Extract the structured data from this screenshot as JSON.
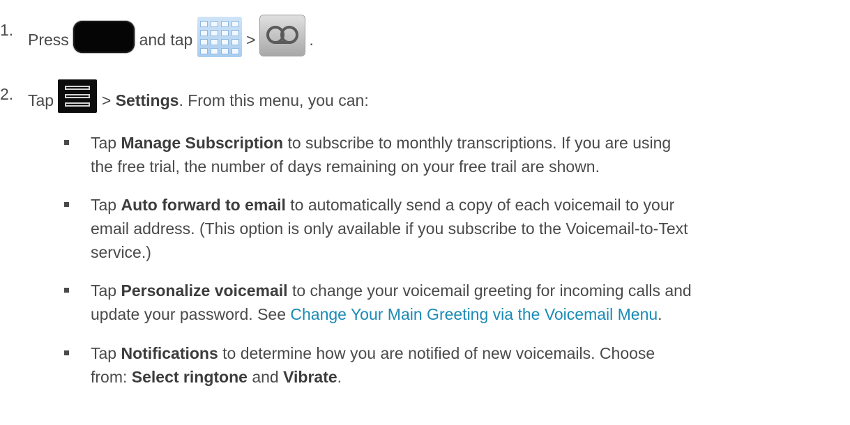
{
  "step1": {
    "number": "1.",
    "press": "Press",
    "and_tap": "and tap",
    "gt": ">",
    "period": ".",
    "home_key_icon": "home-key-icon",
    "apps_icon": "apps-grid-icon",
    "voicemail_icon": "voicemail-icon"
  },
  "step2": {
    "number": "2.",
    "tap": "Tap",
    "gt": ">",
    "settings": "Settings",
    "rest": ". From this menu, you can:",
    "menu_icon": "menu-key-icon"
  },
  "bullets": [
    {
      "lines": [
        {
          "pre": "Tap ",
          "bold": "Manage Subscription",
          "post": " to subscribe to monthly transcriptions. If you are using"
        },
        {
          "pre": "the free trial, the number of days remaining on your free trail are shown.",
          "bold": "",
          "post": ""
        }
      ]
    },
    {
      "lines": [
        {
          "pre": "Tap ",
          "bold": "Auto forward to email",
          "post": " to automatically send a copy of each voicemail to your"
        },
        {
          "pre": "email address. (This option is only available if you subscribe to the Voicemail-to-Text",
          "bold": "",
          "post": ""
        },
        {
          "pre": "service.)",
          "bold": "",
          "post": ""
        }
      ]
    },
    {
      "lines": [
        {
          "pre": "Tap ",
          "bold": "Personalize voicemail",
          "post": " to change your voicemail greeting for incoming calls and"
        },
        {
          "pre": "update your password. See ",
          "link": "Change Your Main Greeting via the Voicemail Menu",
          "post": "."
        }
      ]
    },
    {
      "lines": [
        {
          "pre": "Tap ",
          "bold": "Notifications",
          "post": " to determine how you are notified of new voicemails. Choose"
        },
        {
          "pre": "from: ",
          "bold": "Select ringtone",
          "mid": " and ",
          "bold2": "Vibrate",
          "post": "."
        }
      ]
    }
  ]
}
